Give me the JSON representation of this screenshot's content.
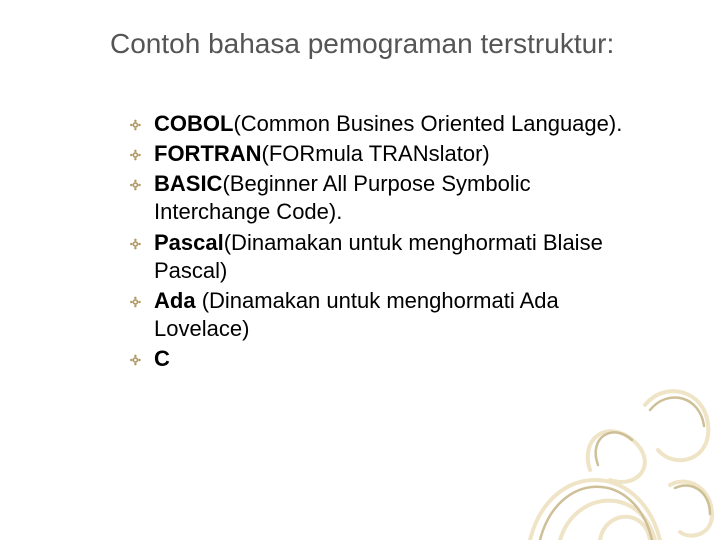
{
  "title": "Contoh bahasa pemograman terstruktur:",
  "bullet_glyph": "༓",
  "items": [
    {
      "bold": "COBOL",
      "rest": "(Common Busines Oriented Language)."
    },
    {
      "bold": "FORTRAN",
      "rest": "(FORmula TRANslator)"
    },
    {
      "bold": "BASIC",
      "rest": "(Beginner All Purpose Symbolic Interchange Code)."
    },
    {
      "bold": "Pascal",
      "rest": "(Dinamakan untuk menghormati Blaise Pascal)"
    },
    {
      "bold": "Ada ",
      "rest": "(Dinamakan untuk menghormati Ada Lovelace)"
    },
    {
      "bold": "C",
      "rest": ""
    }
  ],
  "colors": {
    "bullet": "#b29a66",
    "title": "#555555",
    "swirl_light": "#efe4c6",
    "swirl_dark": "#cdbf96"
  }
}
